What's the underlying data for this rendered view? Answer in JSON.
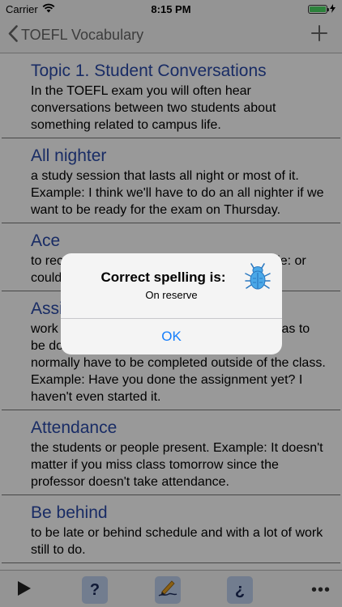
{
  "status_bar": {
    "carrier": "Carrier",
    "time": "8:15 PM"
  },
  "nav": {
    "back_label": "TOEFL Vocabulary"
  },
  "entries": [
    {
      "term": "Topic 1. Student Conversations",
      "definition": "In the TOEFL exam you will often hear conversations between two students about something related to campus life."
    },
    {
      "term": "All nighter",
      "definition": "a study session that lasts all night or most of it. Example: I think we'll have to do an all nighter if we want to be ready for the exam on Thursday."
    },
    {
      "term": "Ace",
      "definition": "to receive a perfect score on a test. Example: or could you believe that I aced the big test."
    },
    {
      "term": "Assignment",
      "definition": "work given to students by the teacher that has to be done as part of studying in a class. They normally have to be completed outside of the class. Example: Have you done the assignment yet? I haven't even started it."
    },
    {
      "term": "Attendance",
      "definition": "the students or people present. Example: It doesn't matter if you miss class tomorrow since the professor doesn't take attendance."
    },
    {
      "term": "Be behind",
      "definition": "to be late or behind schedule and with a lot of work still to do."
    }
  ],
  "toolbar": {
    "help_label": "?",
    "spanish_label": "¿",
    "more_label": "•••"
  },
  "alert": {
    "title": "Correct spelling is:",
    "message": "On reserve",
    "ok_label": "OK"
  },
  "colors": {
    "term": "#2a4aa8",
    "alert_button": "#157efb",
    "toolbar_square": "#bfd0ee",
    "bug_icon": "#4aa8e8"
  },
  "icons": {
    "nav_back": "chevron-left-icon",
    "nav_add": "plus-icon",
    "play": "play-icon",
    "write": "pencil-writing-icon",
    "alert": "bug-icon"
  }
}
